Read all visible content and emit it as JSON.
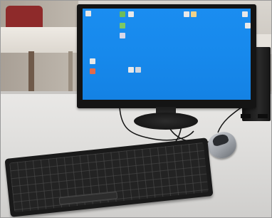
{
  "scene": {
    "colors": {
      "desktop_wallpaper": "#1789ec",
      "monitor_bezel": "#141414",
      "desk_surface": "#e3e2e0",
      "keyboard": "#1a1a1a",
      "mouse_body": "#9ea2a8",
      "tower": "#1c1c1c",
      "chair": "#8e2a2a"
    },
    "desktop": {
      "icons": [
        "desktop-icon",
        "desktop-icon",
        "desktop-icon",
        "desktop-icon",
        "desktop-icon",
        "desktop-icon",
        "desktop-icon",
        "desktop-icon",
        "desktop-icon",
        "desktop-icon",
        "desktop-icon",
        "desktop-icon"
      ]
    }
  }
}
